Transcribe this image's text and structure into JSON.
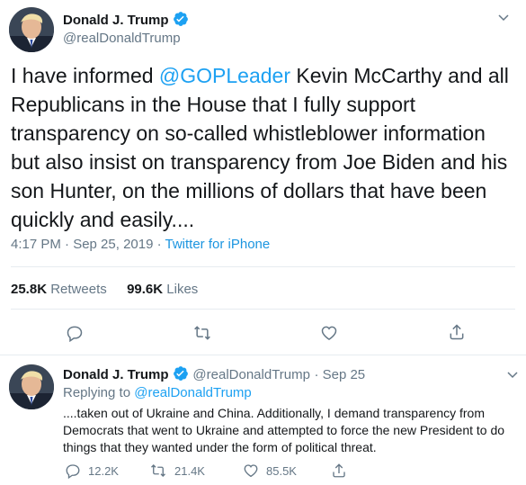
{
  "main_tweet": {
    "author_name": "Donald J. Trump",
    "author_handle": "@realDonaldTrump",
    "text_before_mention": "I have informed ",
    "mention": "@GOPLeader",
    "text_after_mention": " Kevin McCarthy and all Republicans in the House that I fully support transparency on so-called whistleblower information but also insist on transparency from Joe Biden and his son Hunter, on the millions of dollars that have been quickly and easily....",
    "timestamp": "4:17 PM · Sep 25, 2019",
    "separator": " · ",
    "source": "Twitter for iPhone",
    "retweets_count": "25.8K",
    "retweets_label": "Retweets",
    "likes_count": "99.6K",
    "likes_label": "Likes",
    "actions": [
      "reply-icon",
      "retweet-icon",
      "like-icon",
      "share-icon"
    ]
  },
  "reply_tweet": {
    "author_name": "Donald J. Trump",
    "author_handle": "@realDonaldTrump",
    "date": "· Sep 25",
    "replying_label": "Replying to ",
    "replying_to": "@realDonaldTrump",
    "text": "....taken out of Ukraine and China. Additionally, I demand transparency from Democrats that went to Ukraine and attempted to force the new President to do things that they wanted under the form of political threat.",
    "reply_count": "12.2K",
    "retweet_count": "21.4K",
    "like_count": "85.5K"
  },
  "colors": {
    "accent": "#1da1f2",
    "verified": "#1da1f2",
    "text": "#14171a",
    "muted": "#657786",
    "divider": "#e6ecf0"
  }
}
